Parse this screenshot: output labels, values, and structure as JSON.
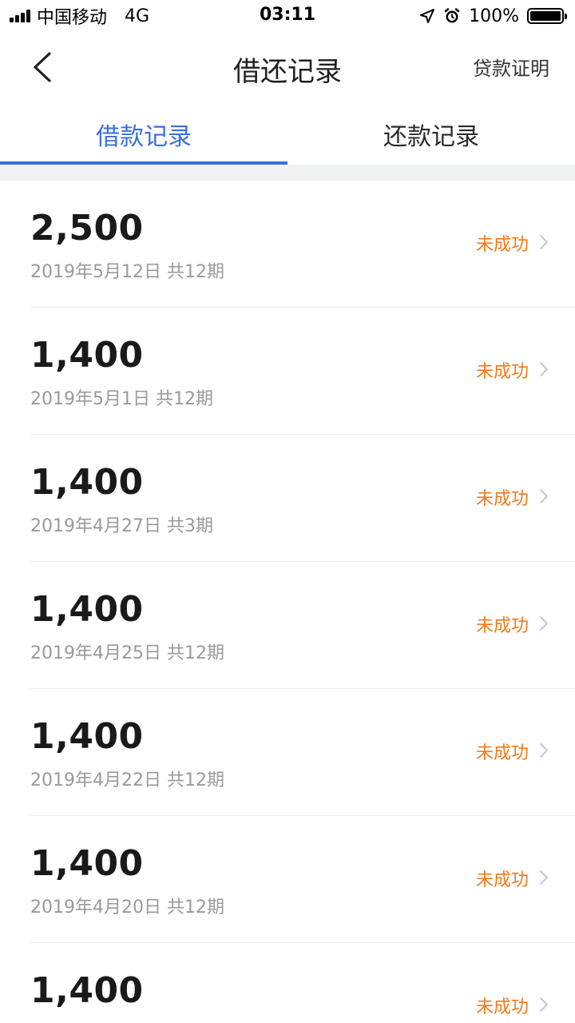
{
  "status_bar": {
    "carrier": "中国移动",
    "network": "4G",
    "time": "03:11",
    "battery_text": "100%",
    "battery_level": 1.0
  },
  "header": {
    "title": "借还记录",
    "right_action": "贷款证明",
    "back_icon": "chevron-left-icon"
  },
  "tabs": [
    {
      "label": "借款记录",
      "active": true
    },
    {
      "label": "还款记录",
      "active": false
    }
  ],
  "loans": [
    {
      "amount": "2,500",
      "meta": "2019年5月12日 共12期",
      "status": "未成功"
    },
    {
      "amount": "1,400",
      "meta": "2019年5月1日 共12期",
      "status": "未成功"
    },
    {
      "amount": "1,400",
      "meta": "2019年4月27日 共3期",
      "status": "未成功"
    },
    {
      "amount": "1,400",
      "meta": "2019年4月25日 共12期",
      "status": "未成功"
    },
    {
      "amount": "1,400",
      "meta": "2019年4月22日 共12期",
      "status": "未成功"
    },
    {
      "amount": "1,400",
      "meta": "2019年4月20日 共12期",
      "status": "未成功"
    },
    {
      "amount": "1,400",
      "meta": "",
      "status": "未成功"
    }
  ],
  "colors": {
    "accent": "#3b6fd8",
    "status_failed": "#f07a1a",
    "meta_text": "#9a9a9a",
    "divider": "#ececec"
  }
}
